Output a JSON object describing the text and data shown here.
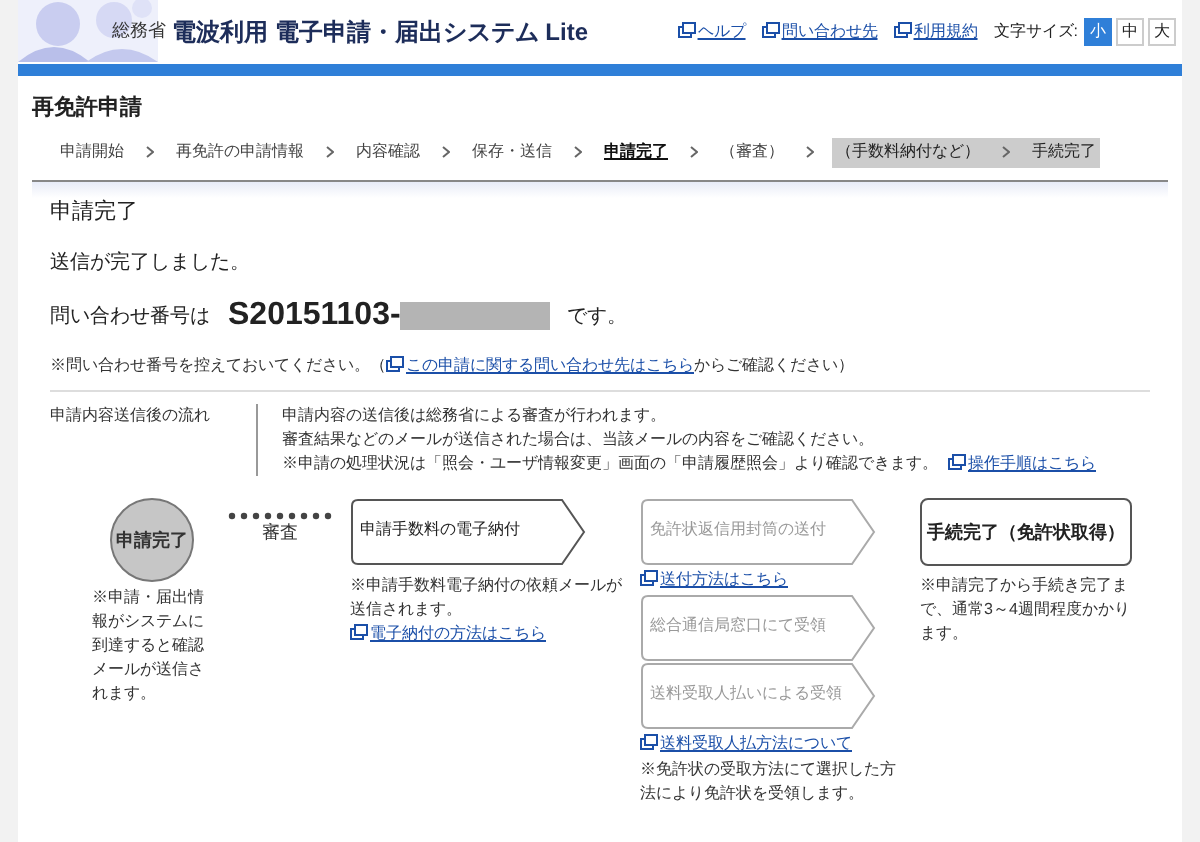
{
  "header": {
    "ministry": "総務省",
    "title": "電波利用 電子申請・届出システム Lite",
    "links": [
      "ヘルプ",
      "問い合わせ先",
      "利用規約"
    ],
    "font_size_label": "文字サイズ:",
    "font_sizes": [
      {
        "label": "小",
        "selected": true
      },
      {
        "label": "中",
        "selected": false
      },
      {
        "label": "大",
        "selected": false
      }
    ]
  },
  "page_title": "再免許申請",
  "steps": [
    {
      "label": "申請開始",
      "selected": false,
      "disabled": false
    },
    {
      "label": "再免許の申請情報",
      "selected": false,
      "disabled": false
    },
    {
      "label": "内容確認",
      "selected": false,
      "disabled": false
    },
    {
      "label": "保存・送信",
      "selected": false,
      "disabled": false
    },
    {
      "label": "申請完了",
      "selected": true,
      "disabled": false
    },
    {
      "label": "（審査）",
      "selected": false,
      "disabled": false
    },
    {
      "label": "（手数料納付など）",
      "selected": false,
      "disabled": true
    },
    {
      "label": "手続完了",
      "selected": false,
      "disabled": true
    }
  ],
  "section_title": "申請完了",
  "message": "送信が完了しました。",
  "inquiry": {
    "label": "問い合わせ番号は",
    "number": "S20151103-",
    "suffix": "です。"
  },
  "note": {
    "before": "※問い合わせ番号を控えておいてください。（",
    "link": "この申請に関する問い合わせ先はこちら",
    "after": "からご確認ください）"
  },
  "flow": {
    "label": "申請内容送信後の流れ",
    "lines": [
      "申請内容の送信後は総務省による審査が行われます。",
      "審査結果などのメールが送信された場合は、当該メールの内容をご確認ください。",
      "※申請の処理状況は「照会・ユーザ情報変更」画面の「申請履歴照会」より確認できます。"
    ],
    "link": "操作手順はこちら"
  },
  "diagram": {
    "done_step": "申請完了",
    "done_note": "※申請・届出情報がシステムに到達すると確認メールが送信されます。",
    "review": "審査",
    "payment": {
      "title": "申請手数料の電子納付",
      "note": "※申請手数料電子納付の依頼メールが送信されます。",
      "link": "電子納付の方法はこちら"
    },
    "options": [
      {
        "title": "免許状返信用封筒の送付",
        "link": "送付方法はこちら"
      },
      {
        "title": "総合通信局窓口にて受領"
      },
      {
        "title": "送料受取人払いによる受領",
        "link": "送料受取人払方法について"
      }
    ],
    "options_note": "※免許状の受取方法にて選択した方法により免許状を受領します。",
    "finish": {
      "title": "手続完了（免許状取得）",
      "note": "※申請完了から手続き完了まで、通常3～4週間程度かかります。"
    }
  }
}
